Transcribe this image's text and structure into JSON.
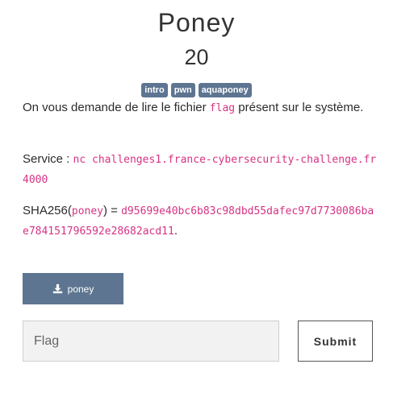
{
  "challenge": {
    "title": "Poney",
    "points": "20",
    "tags": [
      "intro",
      "pwn",
      "aquaponey"
    ]
  },
  "description": {
    "line1_prefix": "On vous demande de lire le fichier ",
    "line1_code": "flag",
    "line1_suffix": " présent sur le système.",
    "service_label": "Service : ",
    "service_command": "nc challenges1.france-cybersecurity-challenge.fr 4000",
    "sha_prefix": "SHA256(",
    "sha_file": "poney",
    "sha_mid": ") = ",
    "sha_hash": "d95699e40bc6b83c98dbd55dafec97d7730086bae784151796592e28682acd11",
    "sha_suffix": "."
  },
  "download": {
    "label": "poney",
    "icon": "download-icon"
  },
  "form": {
    "placeholder": "Flag",
    "submit_label": "Submit"
  },
  "colors": {
    "accent": "#5d7591",
    "code": "#d63384"
  }
}
